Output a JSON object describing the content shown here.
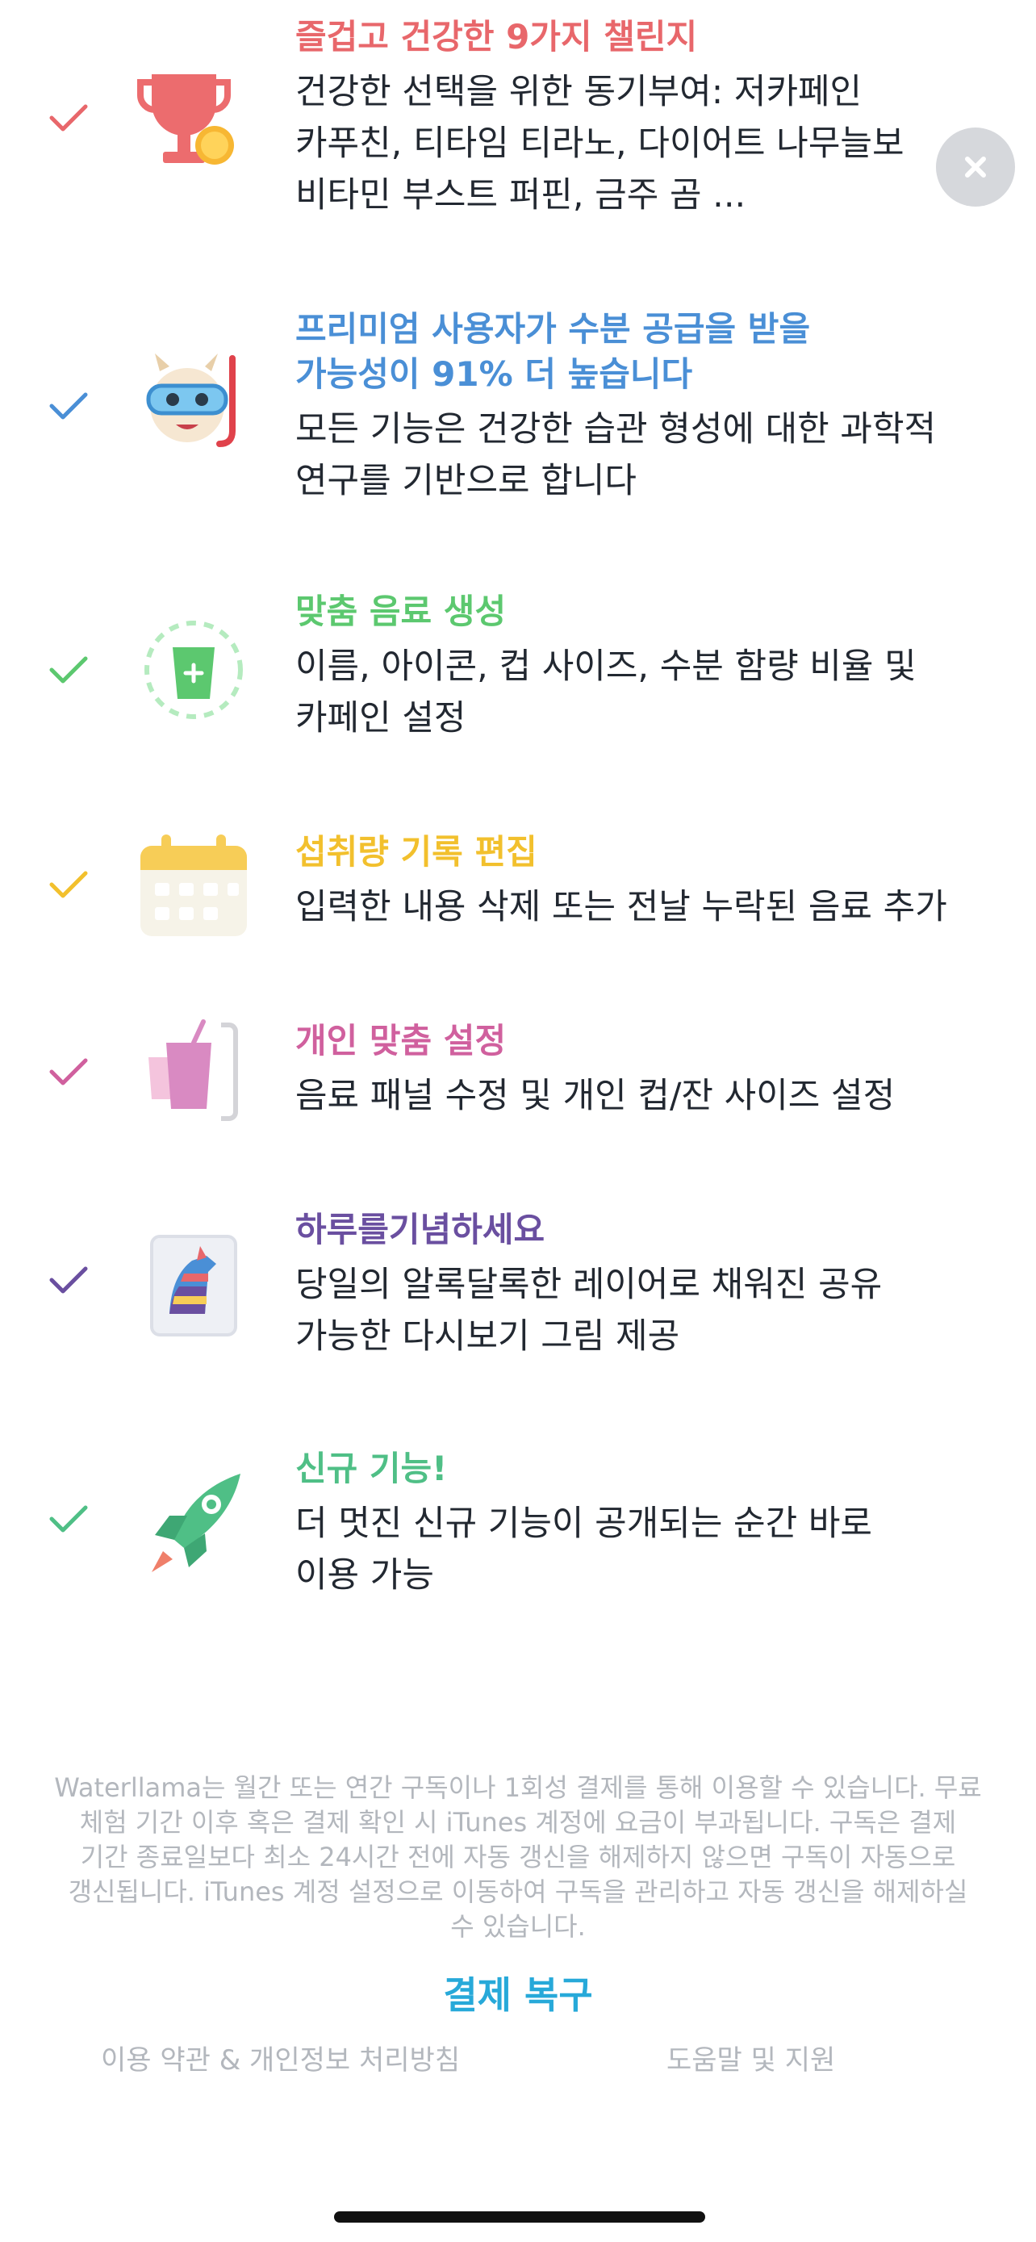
{
  "features": [
    {
      "title": "즐겁고 건강한 9가지 챌린지",
      "desc": [
        "건강한 선택을 위한 동기부여: 저카페인",
        "카푸친, 티타임 티라노, 다이어트 나무늘보",
        "비타민 부스트 퍼핀, 금주 곰 ..."
      ],
      "color": "#e8676b",
      "icon": "trophy-icon"
    },
    {
      "title": [
        "프리미엄 사용자가 수분 공급을 받을",
        "가능성이 91% 더 높습니다"
      ],
      "desc": [
        "모든 기능은 건강한 습관 형성에 대한 과학적",
        "연구를 기반으로 합니다"
      ],
      "color": "#4a8fd6",
      "icon": "llama-snorkel-icon"
    },
    {
      "title": "맞춤 음료 생성",
      "desc": [
        "이름, 아이콘, 컵 사이즈, 수분 함량 비율 및",
        "카페인 설정"
      ],
      "color": "#5cc86f",
      "icon": "custom-drink-icon"
    },
    {
      "title": "섭취량 기록 편집",
      "desc": [
        "입력한 내용 삭제 또는 전날 누락된 음료 추가"
      ],
      "color": "#f2c02d",
      "icon": "calendar-icon"
    },
    {
      "title": "개인 맞춤 설정",
      "desc": [
        "음료 패널 수정 및 개인 컵/잔 사이즈 설정"
      ],
      "color": "#d0609e",
      "icon": "cup-settings-icon"
    },
    {
      "title": "하루를기념하세요",
      "desc": [
        "당일의 알록달록한 레이어로 채워진 공유",
        "가능한 다시보기 그림 제공"
      ],
      "color": "#6a4fa0",
      "icon": "llama-picture-icon"
    },
    {
      "title": "신규 기능!",
      "desc": [
        "더 멋진 신규 기능이 공개되는 순간 바로",
        "이용 가능"
      ],
      "color": "#4fbf86",
      "icon": "rocket-icon"
    }
  ],
  "legal_text": [
    "Waterllama는 월간 또는 연간 구독이나 1회성 결제를 통해 이용할 수 있습니다. 무료",
    "체험 기간 이후 혹은 결제 확인 시 iTunes 계정에 요금이 부과됩니다. 구독은 결제",
    "기간 종료일보다 최소 24시간 전에 자동 갱신을 해제하지 않으면 구독이 자동으로",
    "갱신됩니다. iTunes 계정 설정으로 이동하여 구독을 관리하고 자동 갱신을 해제하실",
    "수 있습니다."
  ],
  "restore_label": "결제 복구",
  "terms_label": "이용 약관 & 개인정보 처리방침",
  "help_label": "도움말 및 지원",
  "close_icon": "close-icon"
}
